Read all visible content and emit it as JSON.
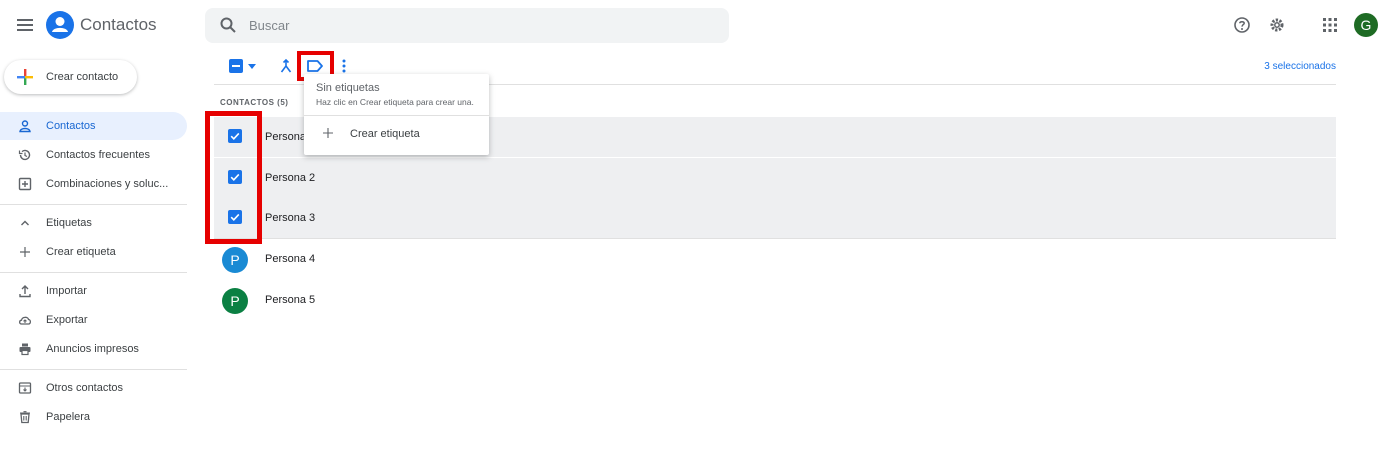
{
  "header": {
    "app_title": "Contactos",
    "search_placeholder": "Buscar",
    "user_initial": "G"
  },
  "sidebar": {
    "create_label": "Crear contacto",
    "items": [
      {
        "label": "Contactos",
        "icon": "person-icon",
        "active": true
      },
      {
        "label": "Contactos frecuentes",
        "icon": "history-icon"
      },
      {
        "label": "Combinaciones y soluc...",
        "icon": "merge-fix-icon"
      },
      {
        "label": "Etiquetas",
        "icon": "chevron-up-icon"
      },
      {
        "label": "Crear etiqueta",
        "icon": "plus-icon"
      },
      {
        "label": "Importar",
        "icon": "upload-icon"
      },
      {
        "label": "Exportar",
        "icon": "cloud-upload-icon"
      },
      {
        "label": "Anuncios impresos",
        "icon": "print-icon"
      },
      {
        "label": "Otros contactos",
        "icon": "archive-icon"
      },
      {
        "label": "Papelera",
        "icon": "trash-icon"
      }
    ]
  },
  "toolbar": {
    "selected_count": "3 seleccionados"
  },
  "list": {
    "header": "CONTACTOS (5)",
    "rows": [
      {
        "name": "Persona",
        "selected": true
      },
      {
        "name": "Persona 2",
        "selected": true
      },
      {
        "name": "Persona 3",
        "selected": true
      },
      {
        "name": "Persona 4",
        "selected": false,
        "initial": "P",
        "color": "#1a8ad4"
      },
      {
        "name": "Persona 5",
        "selected": false,
        "initial": "P",
        "color": "#0b8043"
      }
    ]
  },
  "label_menu": {
    "title": "Sin etiquetas",
    "hint": "Haz clic en Crear etiqueta para crear una.",
    "create_label": "Crear etiqueta"
  },
  "colors": {
    "accent": "#1a73e8",
    "highlight": "#e60000"
  }
}
